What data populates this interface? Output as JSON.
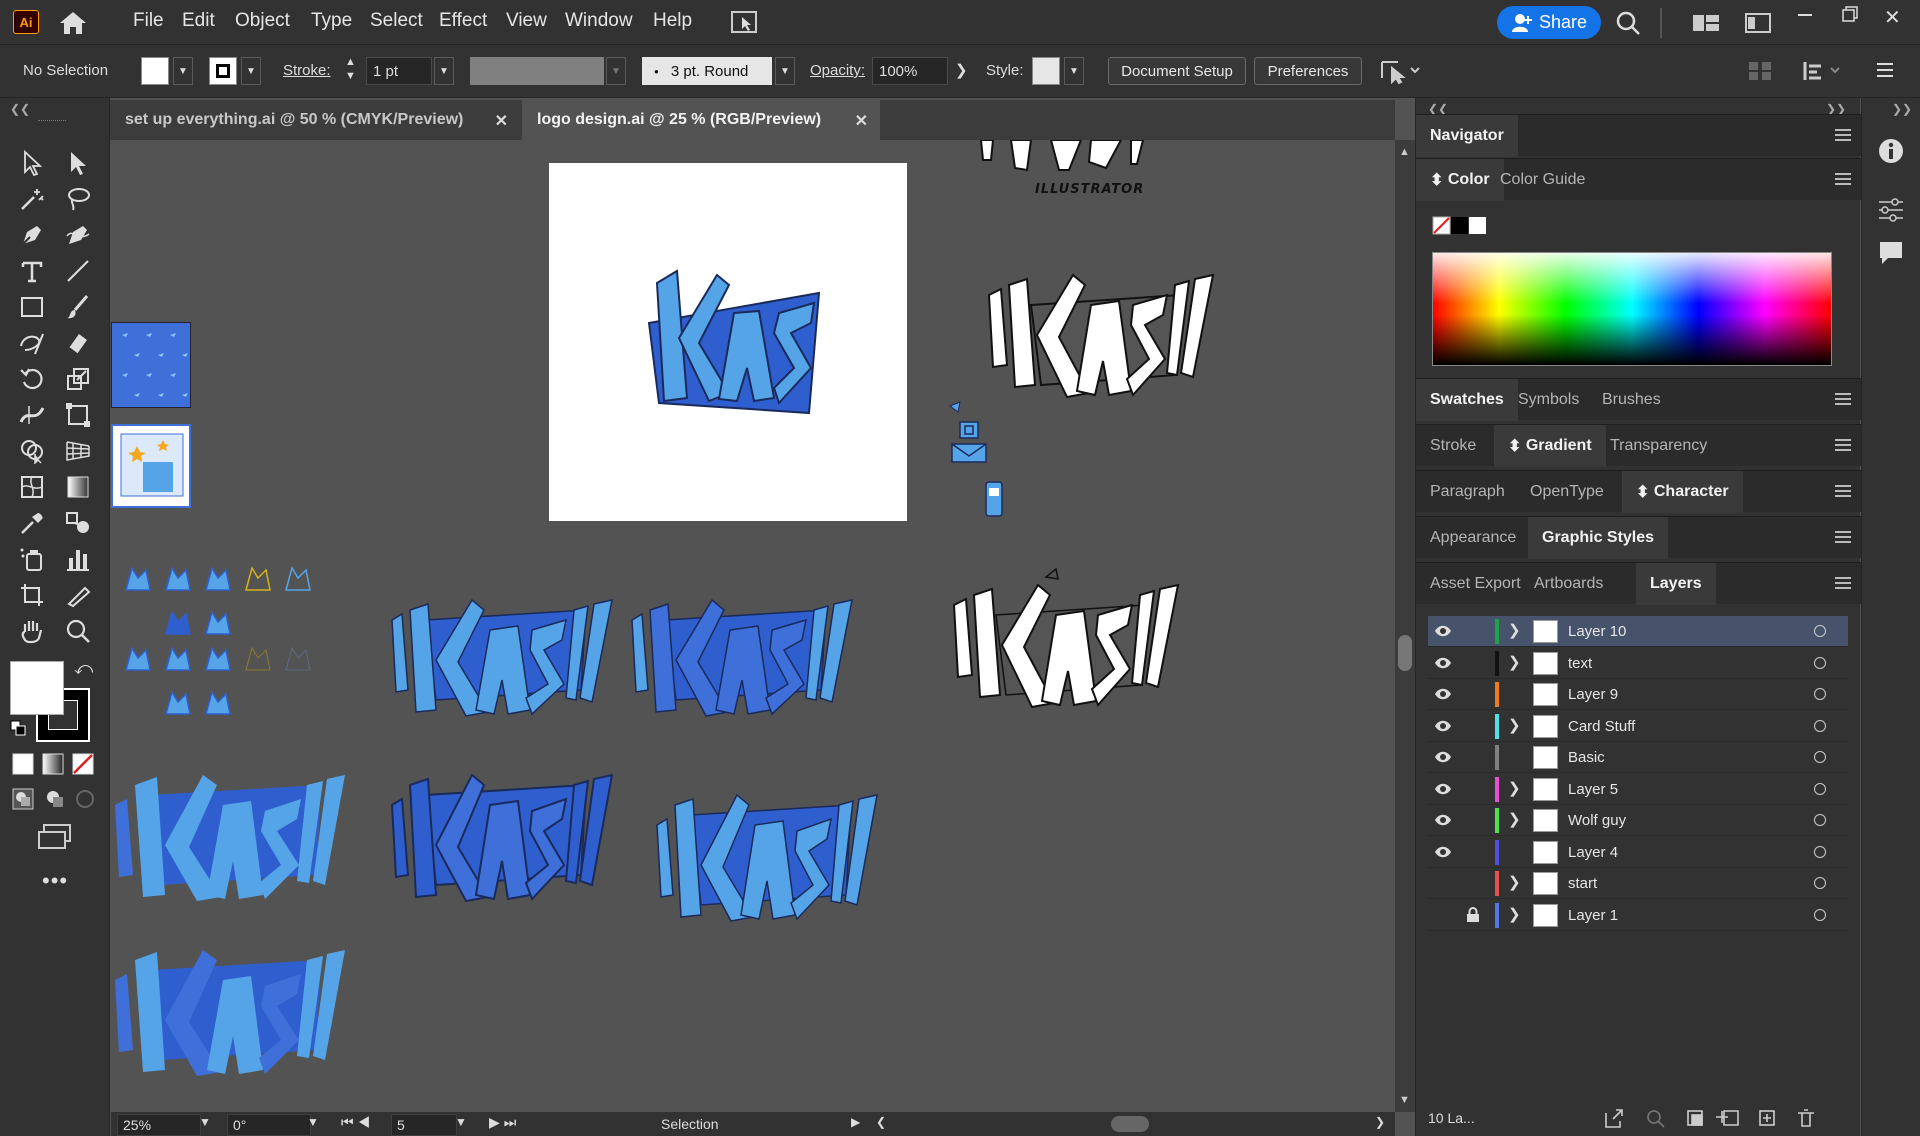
{
  "app": {
    "logo": "Ai"
  },
  "menu": [
    "File",
    "Edit",
    "Object",
    "Type",
    "Select",
    "Effect",
    "View",
    "Window",
    "Help"
  ],
  "share_label": "Share",
  "control": {
    "selection": "No Selection",
    "stroke_label": "Stroke:",
    "stroke_value": "1 pt",
    "brush": "3 pt. Round",
    "opacity_label": "Opacity:",
    "opacity_value": "100%",
    "style_label": "Style:",
    "doc_setup": "Document Setup",
    "preferences": "Preferences"
  },
  "tabs": [
    {
      "label": "set up everything.ai @ 50 % (CMYK/Preview)",
      "active": false
    },
    {
      "label": "logo design.ai @ 25 % (RGB/Preview)",
      "active": true
    }
  ],
  "canvas": {
    "logo_text": "KAS",
    "caption": "ILLUSTRATOR",
    "colors": {
      "blue_dark": "#2f5fcf",
      "blue_light": "#56a4e8",
      "artboard": "#ffffff"
    }
  },
  "status": {
    "zoom": "25%",
    "rotation": "0°",
    "artboard_num": "5",
    "tool": "Selection"
  },
  "panels": {
    "navigator": "Navigator",
    "color_tabs": [
      "Color",
      "Color Guide"
    ],
    "swatch_tabs": [
      "Swatches",
      "Symbols",
      "Brushes"
    ],
    "stroke_tabs": [
      "Stroke",
      "Gradient",
      "Transparency"
    ],
    "para_tabs": [
      "Paragraph",
      "OpenType",
      "Character"
    ],
    "appearance_tabs": [
      "Appearance",
      "Graphic Styles"
    ],
    "asset_tabs": [
      "Asset Export",
      "Artboards",
      "Layers"
    ]
  },
  "layers": [
    {
      "name": "Layer 10",
      "color": "#1fa34a",
      "visible": true,
      "expand": true,
      "locked": false,
      "selected": true
    },
    {
      "name": "text",
      "color": "#111111",
      "visible": true,
      "expand": true,
      "locked": false,
      "selected": false
    },
    {
      "name": "Layer 9",
      "color": "#f07a1c",
      "visible": true,
      "expand": false,
      "locked": false,
      "selected": false
    },
    {
      "name": "Card Stuff",
      "color": "#4fe0e8",
      "visible": true,
      "expand": true,
      "locked": false,
      "selected": false
    },
    {
      "name": "Basic",
      "color": "#808080",
      "visible": true,
      "expand": false,
      "locked": false,
      "selected": false
    },
    {
      "name": "Layer 5",
      "color": "#e84fd6",
      "visible": true,
      "expand": true,
      "locked": false,
      "selected": false
    },
    {
      "name": "Wolf guy",
      "color": "#4fe04f",
      "visible": true,
      "expand": true,
      "locked": false,
      "selected": false
    },
    {
      "name": "Layer 4",
      "color": "#4f4fe0",
      "visible": true,
      "expand": false,
      "locked": false,
      "selected": false
    },
    {
      "name": "start",
      "color": "#e84f4f",
      "visible": false,
      "expand": true,
      "locked": false,
      "selected": false
    },
    {
      "name": "Layer 1",
      "color": "#4f7ae8",
      "visible": false,
      "expand": true,
      "locked": true,
      "selected": false
    }
  ],
  "layers_footer": "10 La..."
}
